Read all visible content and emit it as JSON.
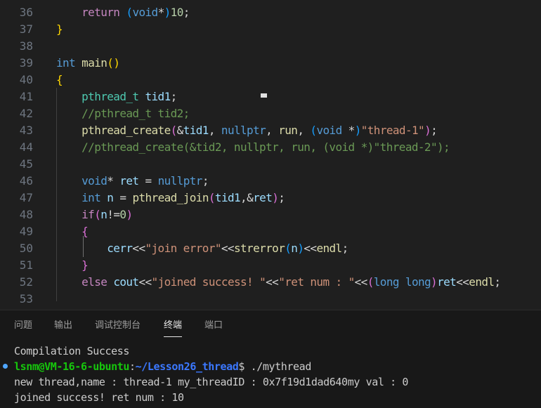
{
  "editor": {
    "lines": [
      {
        "n": "36",
        "tokens": [
          [
            "    ",
            "c-pl"
          ],
          [
            "return",
            "c-ctl"
          ],
          [
            " ",
            "c-pl"
          ],
          [
            "(",
            "c-b3"
          ],
          [
            "void",
            "c-kw"
          ],
          [
            "*",
            "c-pl"
          ],
          [
            ")",
            "c-b3"
          ],
          [
            "10",
            "c-num"
          ],
          [
            ";",
            "c-pl"
          ]
        ]
      },
      {
        "n": "37",
        "tokens": [
          [
            "}",
            "c-b1"
          ]
        ]
      },
      {
        "n": "38",
        "tokens": []
      },
      {
        "n": "39",
        "tokens": [
          [
            "int",
            "c-kw"
          ],
          [
            " ",
            "c-pl"
          ],
          [
            "main",
            "c-fn"
          ],
          [
            "()",
            "c-b1"
          ]
        ]
      },
      {
        "n": "40",
        "tokens": [
          [
            "{",
            "c-b1"
          ]
        ]
      },
      {
        "n": "41",
        "tokens": [
          [
            "    ",
            "c-pl"
          ],
          [
            "pthread_t",
            "c-type"
          ],
          [
            " ",
            "c-pl"
          ],
          [
            "tid1",
            "c-var"
          ],
          [
            ";",
            "c-pl"
          ]
        ]
      },
      {
        "n": "42",
        "tokens": [
          [
            "    ",
            "c-pl"
          ],
          [
            "//pthread_t tid2;",
            "c-com"
          ]
        ]
      },
      {
        "n": "43",
        "tokens": [
          [
            "    ",
            "c-pl"
          ],
          [
            "pthread_create",
            "c-fn"
          ],
          [
            "(",
            "c-b2"
          ],
          [
            "&",
            "c-pl"
          ],
          [
            "tid1",
            "c-var"
          ],
          [
            ", ",
            "c-pl"
          ],
          [
            "nullptr",
            "c-kw"
          ],
          [
            ", ",
            "c-pl"
          ],
          [
            "run",
            "c-fn"
          ],
          [
            ", ",
            "c-pl"
          ],
          [
            "(",
            "c-b3"
          ],
          [
            "void",
            "c-kw"
          ],
          [
            " *",
            "c-pl"
          ],
          [
            ")",
            "c-b3"
          ],
          [
            "\"thread-1\"",
            "c-str"
          ],
          [
            ")",
            "c-b2"
          ],
          [
            ";",
            "c-pl"
          ]
        ]
      },
      {
        "n": "44",
        "tokens": [
          [
            "    ",
            "c-pl"
          ],
          [
            "//pthread_create(&tid2, nullptr, run, (void *)\"thread-2\");",
            "c-com"
          ]
        ]
      },
      {
        "n": "45",
        "tokens": []
      },
      {
        "n": "46",
        "tokens": [
          [
            "    ",
            "c-pl"
          ],
          [
            "void",
            "c-kw"
          ],
          [
            "* ",
            "c-pl"
          ],
          [
            "ret",
            "c-var"
          ],
          [
            " = ",
            "c-pl"
          ],
          [
            "nullptr",
            "c-kw"
          ],
          [
            ";",
            "c-pl"
          ]
        ]
      },
      {
        "n": "47",
        "tokens": [
          [
            "    ",
            "c-pl"
          ],
          [
            "int",
            "c-kw"
          ],
          [
            " ",
            "c-pl"
          ],
          [
            "n",
            "c-var"
          ],
          [
            " = ",
            "c-pl"
          ],
          [
            "pthread_join",
            "c-fn"
          ],
          [
            "(",
            "c-b2"
          ],
          [
            "tid1",
            "c-var"
          ],
          [
            ",&",
            "c-pl"
          ],
          [
            "ret",
            "c-var"
          ],
          [
            ")",
            "c-b2"
          ],
          [
            ";",
            "c-pl"
          ]
        ]
      },
      {
        "n": "48",
        "tokens": [
          [
            "    ",
            "c-pl"
          ],
          [
            "if",
            "c-ctl"
          ],
          [
            "(",
            "c-b2"
          ],
          [
            "n",
            "c-var"
          ],
          [
            "!=",
            "c-pl"
          ],
          [
            "0",
            "c-num"
          ],
          [
            ")",
            "c-b2"
          ]
        ]
      },
      {
        "n": "49",
        "tokens": [
          [
            "    ",
            "c-pl"
          ],
          [
            "{",
            "c-b2"
          ]
        ]
      },
      {
        "n": "50",
        "tokens": [
          [
            "        ",
            "c-pl"
          ],
          [
            "cerr",
            "c-var"
          ],
          [
            "<<",
            "c-pl"
          ],
          [
            "\"join error\"",
            "c-str"
          ],
          [
            "<<",
            "c-pl"
          ],
          [
            "strerror",
            "c-fn"
          ],
          [
            "(",
            "c-b3"
          ],
          [
            "n",
            "c-var"
          ],
          [
            ")",
            "c-b3"
          ],
          [
            "<<",
            "c-pl"
          ],
          [
            "endl",
            "c-fn"
          ],
          [
            ";",
            "c-pl"
          ]
        ]
      },
      {
        "n": "51",
        "tokens": [
          [
            "    ",
            "c-pl"
          ],
          [
            "}",
            "c-b2"
          ]
        ]
      },
      {
        "n": "52",
        "tokens": [
          [
            "    ",
            "c-pl"
          ],
          [
            "else",
            "c-ctl"
          ],
          [
            " ",
            "c-pl"
          ],
          [
            "cout",
            "c-var"
          ],
          [
            "<<",
            "c-pl"
          ],
          [
            "\"joined success! \"",
            "c-str"
          ],
          [
            "<<",
            "c-pl"
          ],
          [
            "\"ret num : \"",
            "c-str"
          ],
          [
            "<<",
            "c-pl"
          ],
          [
            "(",
            "c-b2"
          ],
          [
            "long long",
            "c-kw"
          ],
          [
            ")",
            "c-b2"
          ],
          [
            "ret",
            "c-var"
          ],
          [
            "<<",
            "c-pl"
          ],
          [
            "endl",
            "c-fn"
          ],
          [
            ";",
            "c-pl"
          ]
        ]
      },
      {
        "n": "53",
        "tokens": []
      }
    ]
  },
  "panel": {
    "tabs": [
      {
        "label": "问题",
        "name": "tab-problems"
      },
      {
        "label": "输出",
        "name": "tab-output"
      },
      {
        "label": "调试控制台",
        "name": "tab-debug-console"
      },
      {
        "label": "终端",
        "name": "tab-terminal"
      },
      {
        "label": "端口",
        "name": "tab-ports"
      }
    ],
    "active_tab": "终端"
  },
  "terminal": {
    "compile_msg": "Compilation Success",
    "prompt_user": "lsnm@VM-16-6-ubuntu",
    "prompt_sep": ":",
    "prompt_path": "~/Lesson26_thread",
    "prompt_symbol": "$ ",
    "command": "./mythread",
    "output_line1": "new thread,name : thread-1 my_threadID : 0x7f19d1dad640my val : 0",
    "output_line2": "joined success! ret num : 10"
  }
}
